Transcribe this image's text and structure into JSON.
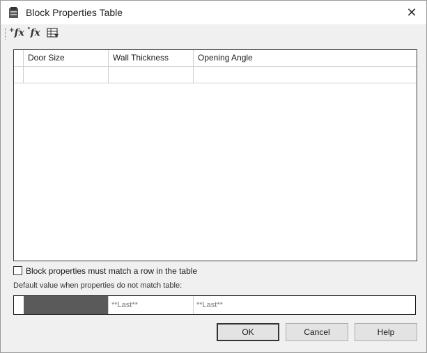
{
  "window": {
    "title": "Block Properties Table",
    "close_glyph": "✕"
  },
  "toolbar": {
    "buttons": [
      {
        "name": "add-property-icon",
        "glyph": "+fx"
      },
      {
        "name": "existing-property-icon",
        "glyph": "°fx"
      },
      {
        "name": "table-settings-icon",
        "glyph": "table"
      }
    ]
  },
  "table": {
    "columns": [
      "Door Size",
      "Wall Thickness",
      "Opening Angle"
    ],
    "rows": [
      [
        "",
        "",
        ""
      ]
    ]
  },
  "options": {
    "match_row_label": "Block properties must match a row in the table",
    "match_row_checked": false
  },
  "defaults": {
    "label": "Default value when properties do not match table:",
    "values": [
      "",
      "**Last**",
      "**Last**"
    ]
  },
  "buttons": {
    "ok": "OK",
    "cancel": "Cancel",
    "help": "Help"
  },
  "colors": {
    "dialog_bg": "#f0f0f0",
    "grid_bg": "#ffffff",
    "selected_cell": "#5a5a5a"
  }
}
